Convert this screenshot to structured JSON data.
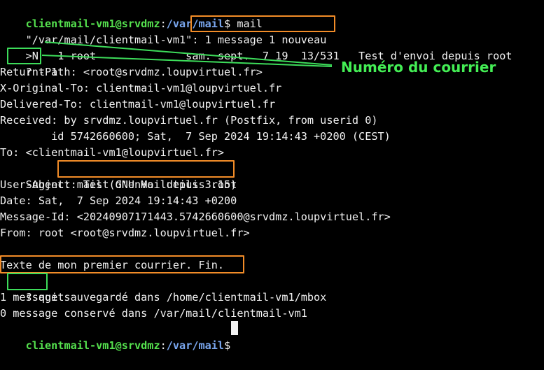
{
  "terminal": {
    "prompt_user_host": "clientmail-vm1@srvdmz",
    "prompt_path": "/var/mail",
    "prompt_symbol": "$",
    "command_mail": " mail",
    "mailbox_path": "\"/var/mail/clientmail-vm1\":",
    "mailbox_summary": "1 message 1 nouveau",
    "header_line": ">N   1 root              sam. sept.  7 19  13/531   Test d'envoi depuis root",
    "prompt_q": "?",
    "command_t1": "t 1",
    "headers": [
      "Return-Path: <root@srvdmz.loupvirtuel.fr>",
      "X-Original-To: clientmail-vm1@loupvirtuel.fr",
      "Delivered-To: clientmail-vm1@loupvirtuel.fr",
      "Received: by srvdmz.loupvirtuel.fr (Postfix, from userid 0)",
      "        id 5742660600; Sat,  7 Sep 2024 19:14:43 +0200 (CEST)",
      "To: <clientmail-vm1@loupvirtuel.fr>"
    ],
    "subject_label": "Subject:",
    "subject_value": "Test d'envoi depuis root",
    "headers_after": [
      "User-Agent: mail (GNU Mailutils 3.15)",
      "Date: Sat,  7 Sep 2024 19:14:43 +0200",
      "Message-Id: <20240907171443.5742660600@srvdmz.loupvirtuel.fr>",
      "From: root <root@srvdmz.loupvirtuel.fr>"
    ],
    "body_text": "Texte de mon premier courrier. Fin.",
    "command_quit": "quit",
    "output_lines": [
      "1 message sauvegardé dans /home/clientmail-vm1/mbox",
      "0 message conservé dans /var/mail/clientmail-vm1"
    ]
  },
  "annotation": {
    "label": "Numéro du courrier",
    "color": "#44ee55"
  },
  "colors": {
    "background": "#000000",
    "text": "#f2f2f2",
    "prompt_green": "#55e14e",
    "path_blue": "#7aa7ef",
    "highlight_orange": "#f28c28",
    "highlight_green": "#3ddc5a"
  }
}
